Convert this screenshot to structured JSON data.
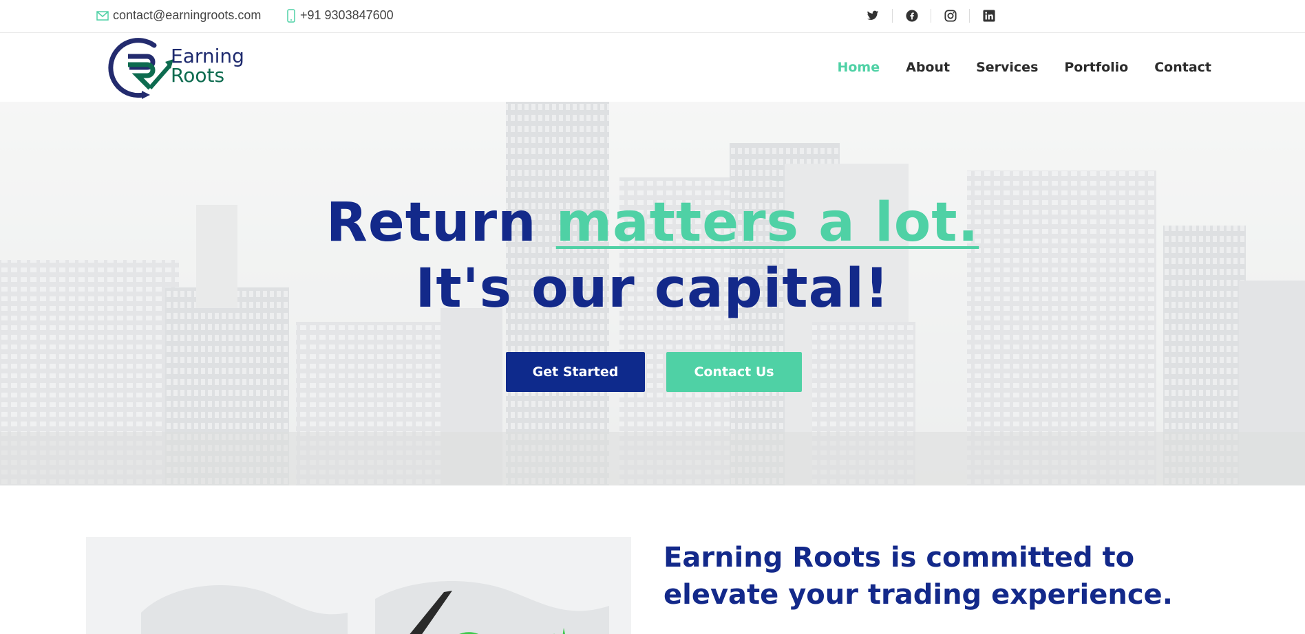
{
  "topbar": {
    "email": "contact@earningroots.com",
    "phone": "+91 9303847600",
    "socials": [
      {
        "name": "twitter-icon"
      },
      {
        "name": "facebook-icon"
      },
      {
        "name": "instagram-icon"
      },
      {
        "name": "linkedin-icon"
      }
    ]
  },
  "header": {
    "logo": {
      "line1": "Earning",
      "line2": "Roots"
    },
    "nav": {
      "home": "Home",
      "about": "About",
      "services": "Services",
      "portfolio": "Portfolio",
      "contact": "Contact"
    },
    "active": "Home"
  },
  "hero": {
    "line1_part1": "Return ",
    "line1_accent": "matters a lot.",
    "line2": "It's our capital!",
    "btn_primary": "Get Started",
    "btn_secondary": "Contact Us"
  },
  "about": {
    "heading": "Earning Roots is committed to elevate your trading experience."
  },
  "colors": {
    "accent": "#4fd1a5",
    "brand_blue": "#13298a",
    "button_blue": "#0e2a8c"
  }
}
